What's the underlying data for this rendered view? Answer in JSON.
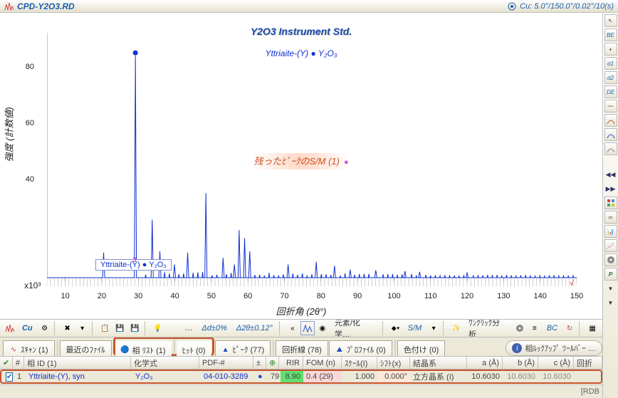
{
  "header": {
    "filename": "CPD-Y2O3.RD",
    "scan_info": "Cu: 5.0°/150.0°/0.02°/10(s)"
  },
  "chart": {
    "title": "Y2O3 Instrument Std.",
    "subtitle_prefix": "Yttriaite-(Y) ",
    "subtitle_dot": "●",
    "subtitle_formula": "Y₂O₃",
    "message": "残ったﾋﾟｰｸのS/M (1)",
    "yaxis": "強度 (計数値)",
    "xaxis": "回折角 (2θ°)",
    "y_mult": "x10³",
    "legend_prefix": "Yttriaite-(Y) ",
    "legend_dot": "●",
    "legend_formula": "Y₂O₃",
    "peak_mark": "3",
    "ticks_y": [
      "80",
      "60",
      "40"
    ],
    "ticks_x": [
      "10",
      "20",
      "30",
      "40",
      "50",
      "60",
      "70",
      "80",
      "90",
      "100",
      "110",
      "120",
      "130",
      "140",
      "150"
    ]
  },
  "chart_data": {
    "type": "line",
    "title": "Y2O3 Instrument Std.",
    "xlabel": "回折角 (2θ°)",
    "ylabel": "強度 (計数値)",
    "x_range": [
      5,
      150
    ],
    "y_range": [
      0,
      90000
    ],
    "y_scale_label": "x10³",
    "series": [
      {
        "name": "Yttriaite-(Y) • Y₂O₃",
        "color": "#1030d0",
        "peaks_x": [
          20.5,
          29.2,
          33.8,
          35.9,
          39.9,
          43.5,
          48.5,
          53.2,
          56.3,
          57.6,
          59.1,
          60.5,
          71.0,
          78.7,
          83.7,
          88.0,
          95.0,
          103.0,
          107.0,
          120.0
        ],
        "peaks_y": [
          9500,
          84000,
          22000,
          10000,
          5000,
          9500,
          32000,
          7500,
          5000,
          18000,
          15000,
          10000,
          5000,
          6000,
          4500,
          3000,
          2800,
          2500,
          2200,
          2000
        ]
      }
    ],
    "unlabeled_peaks": [
      {
        "x": 29.0,
        "label": "3"
      }
    ],
    "annotations": [
      {
        "text": "残ったﾋﾟｰｸのS/M (1)",
        "color": "#cd5020"
      }
    ]
  },
  "toolbar": {
    "cu": "Cu",
    "delta_d": "Δd±0%",
    "delta_2t": "Δ2θ±0.12°",
    "elements": "元素/化学…",
    "sm": "S/M",
    "oneclick": "ﾜﾝｸﾘｯｸ分析",
    "bc": "BC"
  },
  "tabs": {
    "scan": "ｽｷｬﾝ (1)",
    "recent": "最近のﾌｧｲﾙ",
    "phaselist": "相 ﾘｽﾄ (1)",
    "hit": "ﾋｯﾄ (0)",
    "peak": "ﾋﾟｰｸ (77)",
    "diffline": "回折線 (78)",
    "profile": "ﾌﾟﾛﾌｧｲﾙ (0)",
    "color": "色付け (0)",
    "info": "相ﾙｯｸｱｯﾌﾟ ﾂｰﾙﾊﾞｰ …"
  },
  "table": {
    "headers": {
      "check": "✔",
      "num": "#",
      "phase_id": "相 ID (1)",
      "formula": "化学式",
      "pdf": "PDF-#",
      "pm": "±",
      "tree": "⊕",
      "rir": "RIR",
      "fom": "FOM (n)",
      "scale": "ｽｹｰﾙ(I)",
      "shift": "ｼﾌﾄ(x)",
      "crystal": "結晶系",
      "a": "a (Å)",
      "b": "b (Å)",
      "c": "c (Å)",
      "diff": "回折"
    },
    "row": {
      "num": "1",
      "phase_id": "Yttriaite-(Y), syn",
      "formula": "Y₂O₃",
      "pdf": "04-010-3289",
      "pm": "●",
      "tree": "79",
      "rir": "8.90",
      "fom": "0.4 (29)",
      "scale": "1.000",
      "shift": "0.000°",
      "crystal": "立方晶系 (I)",
      "a": "10.6030",
      "b": "10.6030",
      "c": "10.6030"
    }
  },
  "footer": {
    "text": "[RDB"
  }
}
